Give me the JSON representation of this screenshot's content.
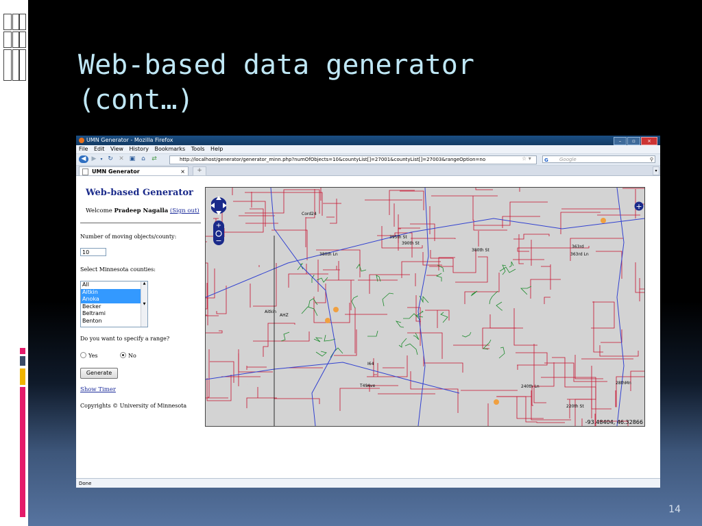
{
  "slide": {
    "title": "Web-based data generator\n(cont…)",
    "page_number": "14"
  },
  "browser": {
    "window_title": "UMN Generator - Mozilla Firefox",
    "menu": [
      "File",
      "Edit",
      "View",
      "History",
      "Bookmarks",
      "Tools",
      "Help"
    ],
    "url": "http://localhost/generator/generator_minn.php?numOfObjects=10&countyList[]=27001&countyList[]=27003&rangeOption=no",
    "search_placeholder": "Google",
    "tab_title": "UMN Generator",
    "status": "Done"
  },
  "page": {
    "heading": "Web-based Generator",
    "welcome_prefix": "Welcome",
    "user_name": "Pradeep Nagalla",
    "sign_out": "(Sign out)",
    "count_label": "Number of moving objects/county:",
    "count_value": "10",
    "counties_label": "Select Minnesota counties:",
    "counties": [
      {
        "name": "All",
        "selected": false
      },
      {
        "name": "Aitkin",
        "selected": true
      },
      {
        "name": "Anoka",
        "selected": true
      },
      {
        "name": "Becker",
        "selected": false
      },
      {
        "name": "Beltrami",
        "selected": false
      },
      {
        "name": "Benton",
        "selected": false
      }
    ],
    "range_question": "Do you want to specify a range?",
    "range_yes": "Yes",
    "range_no": "No",
    "range_selected": "No",
    "generate_button": "Generate",
    "show_timer": "Show Timer",
    "copyright": "Copyrights © University of Minnesota"
  },
  "map": {
    "coordinates": "-93.48404, 46.32866",
    "road_labels": [
      "395th St",
      "390th St",
      "380th Ln",
      "380th St",
      "363rd",
      "363rd Ln",
      "Cord24",
      "Aitkin",
      "AHZ",
      "I64",
      "T49Ave",
      "240th Ln",
      "220th St",
      "28thMn"
    ]
  }
}
